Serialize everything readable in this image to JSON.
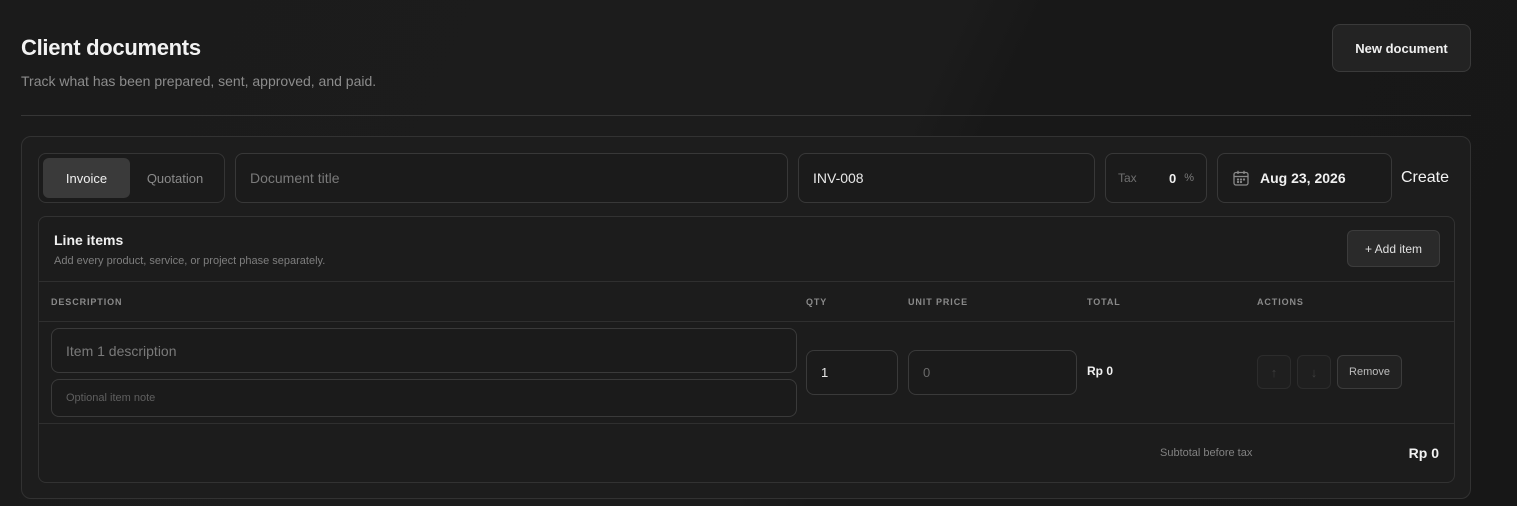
{
  "header": {
    "title": "Client documents",
    "subtitle": "Track what has been prepared, sent, approved, and paid.",
    "new_document_label": "New document"
  },
  "form": {
    "doc_types": [
      {
        "label": "Invoice",
        "selected": true
      },
      {
        "label": "Quotation",
        "selected": false
      }
    ],
    "title_placeholder": "Document title",
    "document_number": "INV-008",
    "tax": {
      "label": "Tax",
      "value": "0",
      "unit": "%"
    },
    "date": {
      "icon": "calendar-icon",
      "value": "Aug 23, 2026"
    },
    "create_label": "Create"
  },
  "line_items": {
    "title": "Line items",
    "subtitle": "Add every product, service, or project phase separately.",
    "add_item_label": "+ Add item",
    "columns": [
      "DESCRIPTION",
      "QTY",
      "UNIT PRICE",
      "TOTAL",
      "ACTIONS"
    ],
    "rows": [
      {
        "description_placeholder": "Item 1 description",
        "note_placeholder": "Optional item note",
        "qty": "1",
        "unit_price_placeholder": "0",
        "total": "Rp 0",
        "move_up_glyph": "↑",
        "move_down_glyph": "↓",
        "remove_label": "Remove"
      }
    ],
    "subtotal_label": "Subtotal before tax",
    "subtotal_value": "Rp 0"
  },
  "colors": {
    "background": "#1a1a1a",
    "card": "#1d1d1d",
    "border": "#323232",
    "active_segment": "#3a3a3a"
  }
}
